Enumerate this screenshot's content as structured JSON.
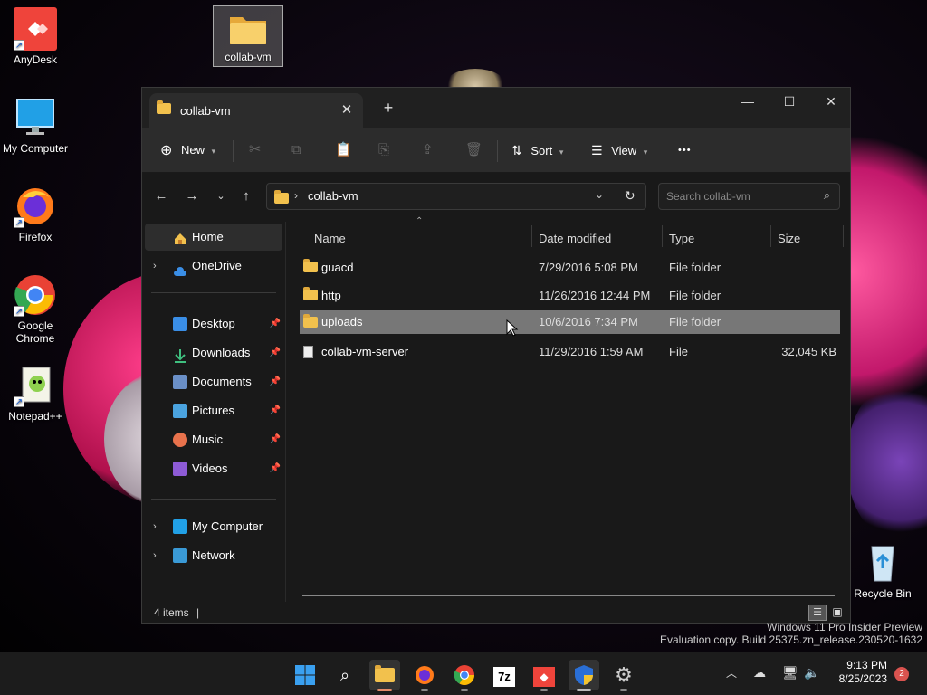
{
  "desktop": {
    "icons": [
      {
        "label": "AnyDesk",
        "icon": "anydesk-icon"
      },
      {
        "label": "My Computer",
        "icon": "monitor-icon"
      },
      {
        "label": "Firefox",
        "icon": "firefox-icon"
      },
      {
        "label": "Google Chrome",
        "icon": "chrome-icon"
      },
      {
        "label": "Notepad++",
        "icon": "notepadpp-icon"
      },
      {
        "label": "collab-vm",
        "icon": "folder-icon"
      },
      {
        "label": "Recycle Bin",
        "icon": "recycle-bin-icon"
      }
    ],
    "watermark_line1": "Windows 11 Pro Insider Preview",
    "watermark_line2": "Evaluation copy. Build 25375.zn_release.230520-1632"
  },
  "explorer": {
    "tab_title": "collab-vm",
    "tab_close": "✕",
    "new_tab": "+",
    "window_controls": {
      "minimize": "—",
      "maximize": "☐",
      "close": "✕"
    },
    "toolbar": {
      "new_label": "New",
      "sort_label": "Sort",
      "view_label": "View",
      "more_label": "•••"
    },
    "address": {
      "path": "collab-vm",
      "search_placeholder": "Search collab-vm"
    },
    "nav": {
      "home": "Home",
      "onedrive": "OneDrive",
      "pinned": [
        {
          "label": "Desktop",
          "color": "#3a8ee6"
        },
        {
          "label": "Downloads",
          "color": "#3fbf7f"
        },
        {
          "label": "Documents",
          "color": "#6a8fc7"
        },
        {
          "label": "Pictures",
          "color": "#4aa3df"
        },
        {
          "label": "Music",
          "color": "#e8724c"
        },
        {
          "label": "Videos",
          "color": "#8e5bd6"
        }
      ],
      "my_computer": "My Computer",
      "network": "Network"
    },
    "columns": {
      "name": "Name",
      "date": "Date modified",
      "type": "Type",
      "size": "Size"
    },
    "files": [
      {
        "name": "guacd",
        "date": "7/29/2016 5:08 PM",
        "type": "File folder",
        "size": "",
        "kind": "folder",
        "selected": false
      },
      {
        "name": "http",
        "date": "11/26/2016 12:44 PM",
        "type": "File folder",
        "size": "",
        "kind": "folder",
        "selected": false
      },
      {
        "name": "uploads",
        "date": "10/6/2016 7:34 PM",
        "type": "File folder",
        "size": "",
        "kind": "folder",
        "selected": true
      },
      {
        "name": "collab-vm-server",
        "date": "11/29/2016 1:59 AM",
        "type": "File",
        "size": "32,045 KB",
        "kind": "file",
        "selected": false
      }
    ],
    "status": "4 items"
  },
  "taskbar": {
    "clock_time": "9:13 PM",
    "clock_date": "8/25/2023",
    "notification_count": "2",
    "seven_zip_label": "7z"
  }
}
